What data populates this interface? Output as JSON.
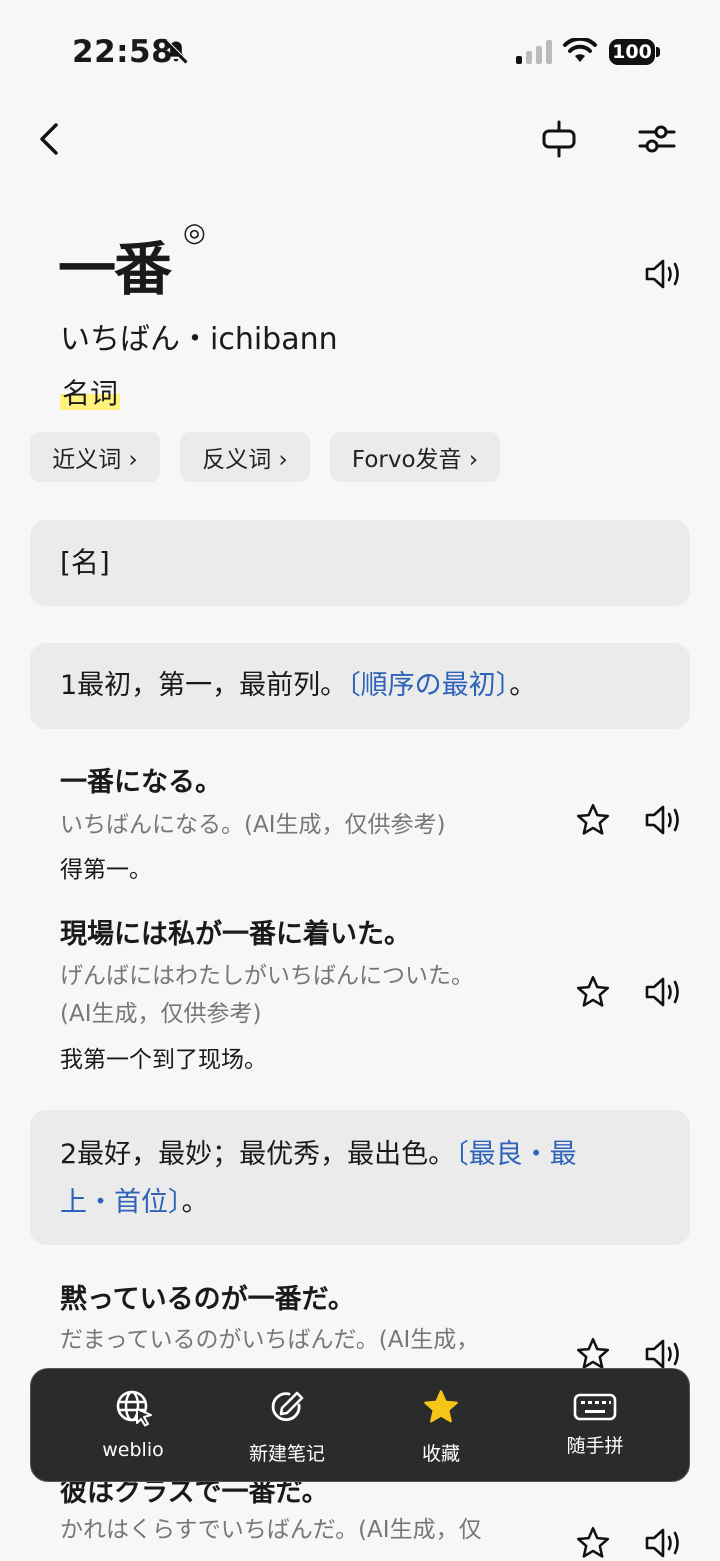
{
  "status": {
    "time": "22:58",
    "battery": "100"
  },
  "entry": {
    "word": "一番",
    "mark": "◎",
    "reading": "いちばん・ichibann",
    "pos": "名词"
  },
  "chips": [
    {
      "label": "近义词 ›"
    },
    {
      "label": "反义词 ›"
    },
    {
      "label": "Forvo发音 ›"
    }
  ],
  "section": {
    "label": "[名]"
  },
  "senses": [
    {
      "text": "1最初，第一，最前列。",
      "link": "〔順序の最初〕",
      "end": "。"
    },
    {
      "text": "2最好，最妙；最优秀，最出色。",
      "link_line1": "〔最良・最",
      "link_line2": "上・首位〕",
      "end": "。"
    }
  ],
  "examples": [
    {
      "jp": "一番になる。",
      "reading": "いちばんになる。(AI生成，仅供参考)",
      "cn": "得第一。"
    },
    {
      "jp": "現場には私が一番に着いた。",
      "reading_line1": "げんばにはわたしがいちばんについた。",
      "reading_line2": "(AI生成，仅供参考)",
      "cn": "我第一个到了现场。"
    },
    {
      "jp": "黙っているのが一番だ。",
      "reading": "だまっているのがいちばんだ。(AI生成，"
    },
    {
      "jp": "彼はクラスで一番だ。",
      "reading": "かれはくらすでいちばんだ。(AI生成，仅"
    }
  ],
  "toolbar": {
    "items": [
      {
        "label": "weblio"
      },
      {
        "label": "新建笔记"
      },
      {
        "label": "收藏"
      },
      {
        "label": "随手拼"
      }
    ]
  },
  "colors": {
    "accent_link": "#2d63b8",
    "highlight": "#fff27a",
    "star": "#f5c518",
    "toolbar_bg": "#2b2b2b"
  }
}
